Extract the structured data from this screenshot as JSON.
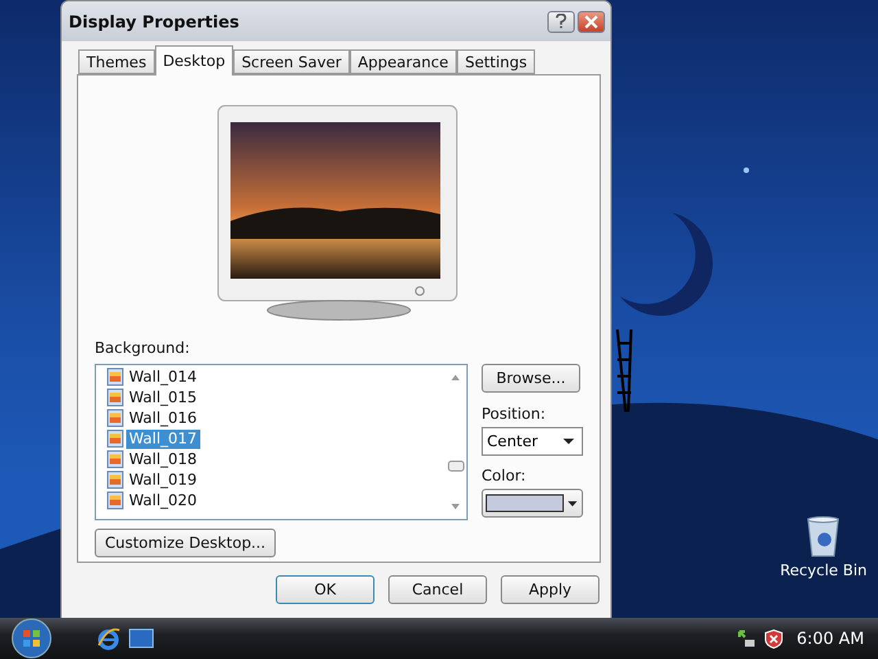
{
  "window": {
    "title": "Display Properties"
  },
  "tabs": [
    {
      "label": "Themes",
      "selected": false
    },
    {
      "label": "Desktop",
      "selected": true
    },
    {
      "label": "Screen Saver",
      "selected": false
    },
    {
      "label": "Appearance",
      "selected": false
    },
    {
      "label": "Settings",
      "selected": false
    }
  ],
  "background": {
    "label": "Background:",
    "items": [
      {
        "name": "Wall_014",
        "selected": false
      },
      {
        "name": "Wall_015",
        "selected": false
      },
      {
        "name": "Wall_016",
        "selected": false
      },
      {
        "name": "Wall_017",
        "selected": true
      },
      {
        "name": "Wall_018",
        "selected": false
      },
      {
        "name": "Wall_019",
        "selected": false
      },
      {
        "name": "Wall_020",
        "selected": false
      }
    ]
  },
  "browse_button": "Browse...",
  "position": {
    "label": "Position:",
    "value": "Center"
  },
  "color_picker": {
    "label": "Color:",
    "color": "#c6cadf"
  },
  "customize_button": "Customize Desktop...",
  "buttons": [
    "OK",
    "Cancel",
    "Apply"
  ],
  "desktop_icons": [
    {
      "label": "Recycle Bin"
    }
  ],
  "taskbar": {
    "clock": "6:00 AM"
  }
}
